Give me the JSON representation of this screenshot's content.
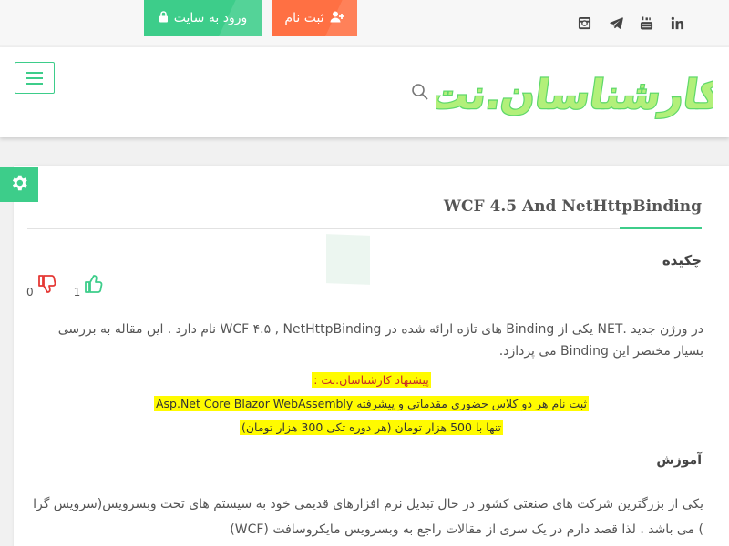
{
  "topbar": {
    "login_label": "ورود به سایت",
    "register_label": "ثبت نام",
    "social_icons": [
      "instagram-icon",
      "telegram-icon",
      "youtube-icon",
      "linkedin-icon"
    ]
  },
  "header": {
    "logo_text": "کارشناسان.نت",
    "colors": {
      "accent": "#3dcd8a",
      "register": "#ff7043",
      "logo_fill": "#b2f07a"
    }
  },
  "post": {
    "title": "WCF 4.5 And NetHttpBinding",
    "abstract_title": "چکیده",
    "likes": "1",
    "dislikes": "0",
    "abstract_text": "در ورژن جدید .NET یکی از Binding های تازه ارائه شده در WCF ۴.۵ , NetHttpBinding نام دارد . این مقاله به بررسی بسیار مختصر این Binding می پردازد.",
    "suggestion_label": "پیشنهاد کارشناسان.نت :",
    "suggestion_line1": "ثبت نام هر دو کلاس حضوری مقدماتی و پیشرفته Asp.Net Core Blazor WebAssembly",
    "suggestion_line2": "تنها با 500 هزار تومان (هر دوره تکی 300 هزار تومان)",
    "tutorial_title": "آموزش",
    "tutorial_text": "یکی از بزرگترین شرکت های صنعتی کشور در حال تبدیل نرم افزارهای قدیمی خود به سیستم های تحت وبسرویس(سرویس گرا ) می باشد . لذا قصد دارم در یک سری از مقالات راجع به وبسرویس مایکروسافت (WCF)"
  }
}
